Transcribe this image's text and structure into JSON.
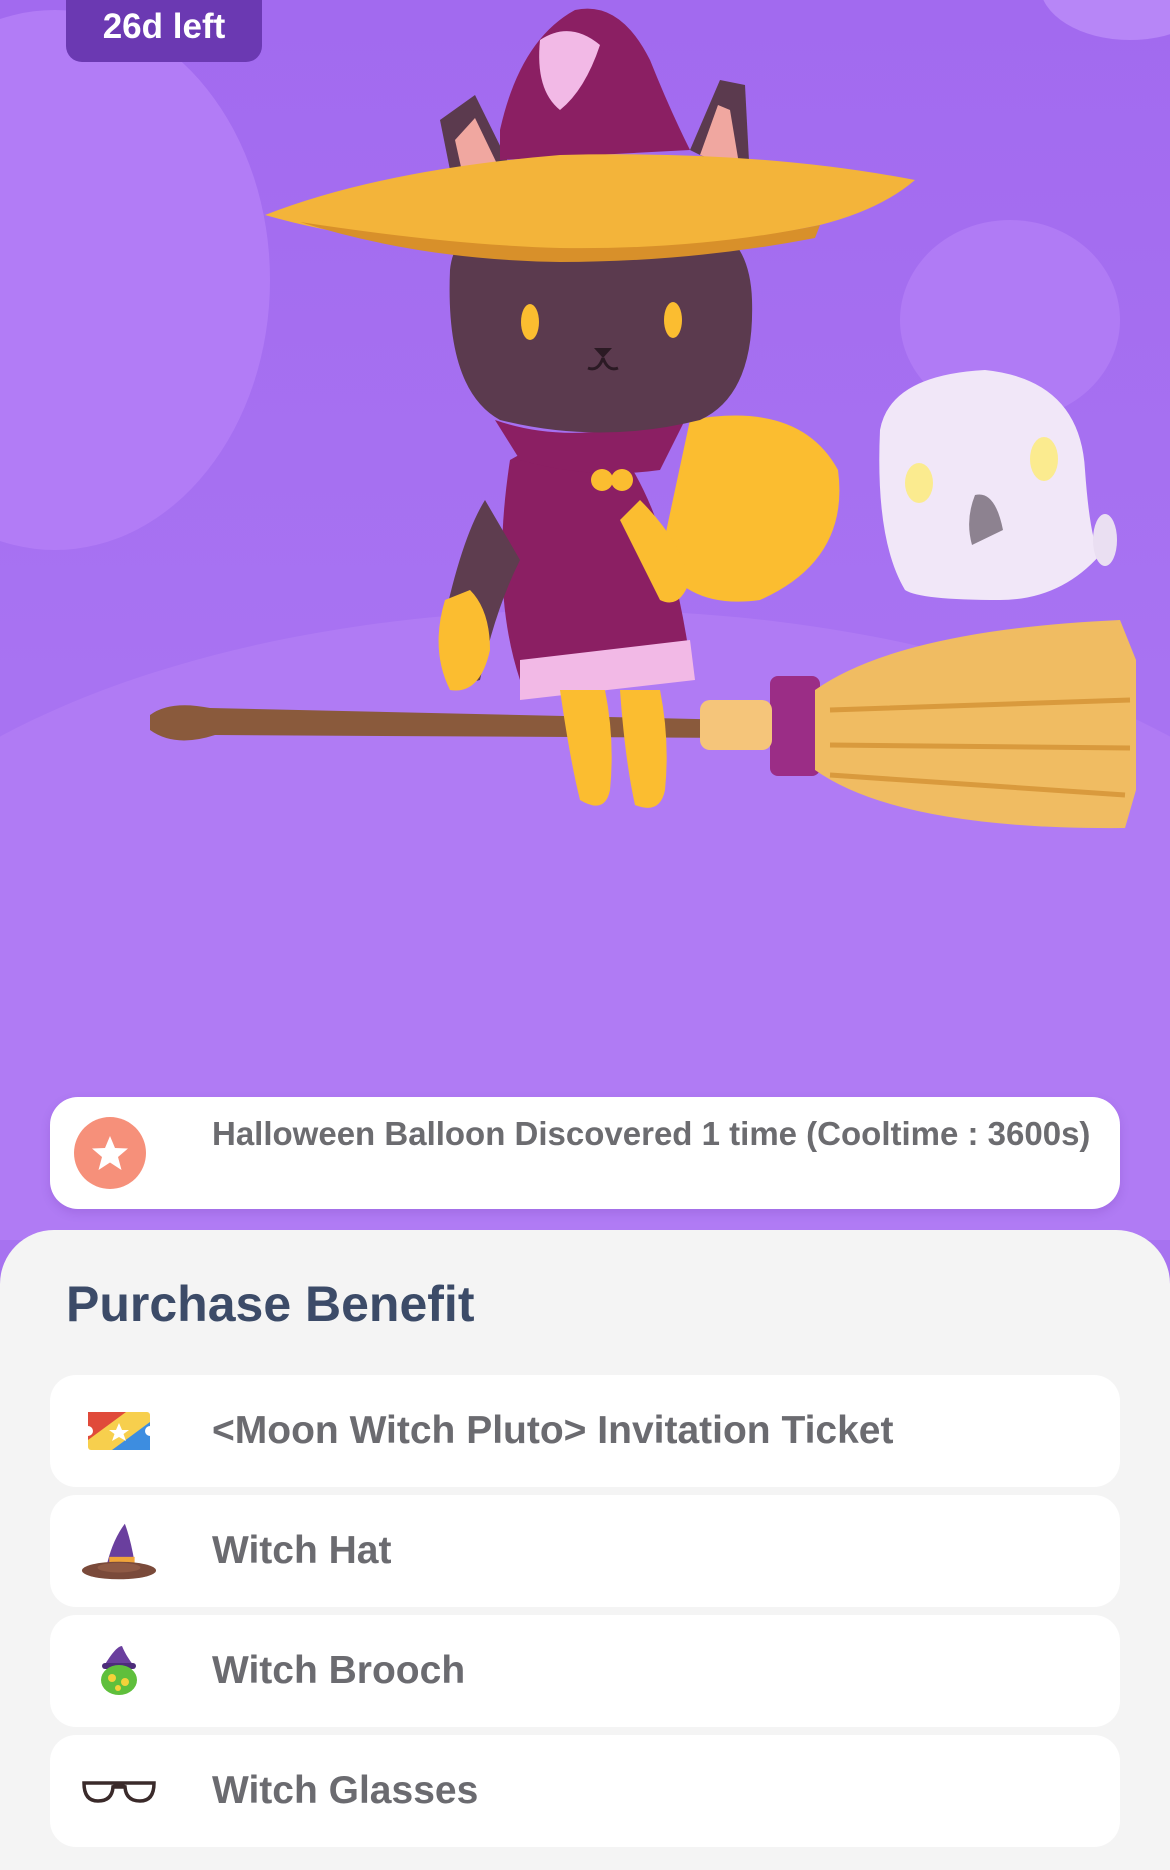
{
  "banner": {
    "timer_label": "26d left"
  },
  "event": {
    "icon": "star-icon",
    "text": "Halloween Balloon Discovered 1 time (Cooltime : 3600s)"
  },
  "purchase_benefit": {
    "title": "Purchase Benefit",
    "items": [
      {
        "icon": "ticket-icon",
        "label": "<Moon Witch Pluto> Invitation Ticket"
      },
      {
        "icon": "witch-hat-icon",
        "label": "Witch Hat"
      },
      {
        "icon": "witch-brooch-icon",
        "label": "Witch Brooch"
      },
      {
        "icon": "glasses-icon",
        "label": "Witch Glasses"
      }
    ]
  },
  "colors": {
    "hero_background": "#a772f0",
    "timer_badge": "#6b39b2",
    "event_icon": "#f6907a",
    "sheet_background": "#f4f4f4",
    "title_text": "#3c4b68"
  }
}
